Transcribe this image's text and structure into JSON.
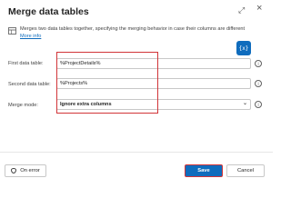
{
  "dialog": {
    "title": "Merge data tables",
    "controls": {
      "expand": "⤢",
      "close": "×"
    }
  },
  "info": {
    "text": "Merges two data tables together, specifying the merging behavior in case their columns are different",
    "more_info": "More info"
  },
  "variable_button": "{x}",
  "fields": {
    "first": {
      "label": "First data table:",
      "value": "%ProjectDetails%"
    },
    "second": {
      "label": "Second data table:",
      "value": "%Projects%"
    },
    "merge_mode": {
      "label": "Merge mode:",
      "value": "Ignore extra columns"
    }
  },
  "help_glyph": "i",
  "chevron_glyph": "⌄",
  "buttons": {
    "on_error": "On error",
    "save": "Save",
    "cancel": "Cancel"
  },
  "colors": {
    "accent": "#0f6cbd",
    "highlight": "#d13438"
  }
}
